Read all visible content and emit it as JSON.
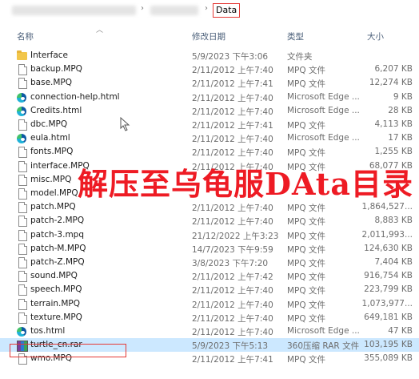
{
  "breadcrumb": {
    "current": "Data"
  },
  "columns": {
    "name": "名称",
    "date": "修改日期",
    "type": "类型",
    "size": "大小"
  },
  "overlay_text": "解压至乌龟服DAta目录",
  "files": [
    {
      "name": "Interface",
      "date": "5/9/2023 下午3:06",
      "type": "文件夹",
      "size": "",
      "icon": "folder"
    },
    {
      "name": "backup.MPQ",
      "date": "2/11/2012 上午7:40",
      "type": "MPQ 文件",
      "size": "6,207 KB",
      "icon": "file"
    },
    {
      "name": "base.MPQ",
      "date": "2/11/2012 上午7:41",
      "type": "MPQ 文件",
      "size": "12,274 KB",
      "icon": "file"
    },
    {
      "name": "connection-help.html",
      "date": "2/11/2012 上午7:40",
      "type": "Microsoft Edge ...",
      "size": "9 KB",
      "icon": "edge"
    },
    {
      "name": "Credits.html",
      "date": "2/11/2012 上午7:40",
      "type": "Microsoft Edge ...",
      "size": "28 KB",
      "icon": "edge"
    },
    {
      "name": "dbc.MPQ",
      "date": "2/11/2012 上午7:41",
      "type": "MPQ 文件",
      "size": "4,113 KB",
      "icon": "file"
    },
    {
      "name": "eula.html",
      "date": "2/11/2012 上午7:40",
      "type": "Microsoft Edge ...",
      "size": "17 KB",
      "icon": "edge"
    },
    {
      "name": "fonts.MPQ",
      "date": "2/11/2012 上午7:40",
      "type": "MPQ 文件",
      "size": "1,255 KB",
      "icon": "file"
    },
    {
      "name": "interface.MPQ",
      "date": "2/11/2012 上午7:40",
      "type": "MPQ 文件",
      "size": "68,077 KB",
      "icon": "file"
    },
    {
      "name": "misc.MPQ",
      "date": "",
      "type": "",
      "size": "",
      "icon": "file"
    },
    {
      "name": "model.MPQ",
      "date": "",
      "type": "",
      "size": "",
      "icon": "file"
    },
    {
      "name": "patch.MPQ",
      "date": "2/11/2012 上午7:40",
      "type": "MPQ 文件",
      "size": "1,864,527...",
      "icon": "file"
    },
    {
      "name": "patch-2.MPQ",
      "date": "2/11/2012 上午7:40",
      "type": "MPQ 文件",
      "size": "8,883 KB",
      "icon": "file"
    },
    {
      "name": "patch-3.mpq",
      "date": "21/12/2022 上午3:23",
      "type": "MPQ 文件",
      "size": "2,011,993...",
      "icon": "file"
    },
    {
      "name": "patch-M.MPQ",
      "date": "14/7/2023 下午9:59",
      "type": "MPQ 文件",
      "size": "124,630 KB",
      "icon": "file"
    },
    {
      "name": "patch-Z.MPQ",
      "date": "3/8/2023 下午7:20",
      "type": "MPQ 文件",
      "size": "7,404 KB",
      "icon": "file"
    },
    {
      "name": "sound.MPQ",
      "date": "2/11/2012 上午7:42",
      "type": "MPQ 文件",
      "size": "916,754 KB",
      "icon": "file"
    },
    {
      "name": "speech.MPQ",
      "date": "2/11/2012 上午7:40",
      "type": "MPQ 文件",
      "size": "223,799 KB",
      "icon": "file"
    },
    {
      "name": "terrain.MPQ",
      "date": "2/11/2012 上午7:40",
      "type": "MPQ 文件",
      "size": "1,073,977...",
      "icon": "file"
    },
    {
      "name": "texture.MPQ",
      "date": "2/11/2012 上午7:40",
      "type": "MPQ 文件",
      "size": "649,181 KB",
      "icon": "file"
    },
    {
      "name": "tos.html",
      "date": "2/11/2012 上午7:40",
      "type": "Microsoft Edge ...",
      "size": "47 KB",
      "icon": "edge"
    },
    {
      "name": "turtle_cn.rar",
      "date": "5/9/2023 下午5:13",
      "type": "360压缩 RAR 文件",
      "size": "103,195 KB",
      "icon": "rar",
      "selected": true
    },
    {
      "name": "wmo.MPQ",
      "date": "2/11/2012 上午7:41",
      "type": "MPQ 文件",
      "size": "355,089 KB",
      "icon": "file"
    }
  ]
}
